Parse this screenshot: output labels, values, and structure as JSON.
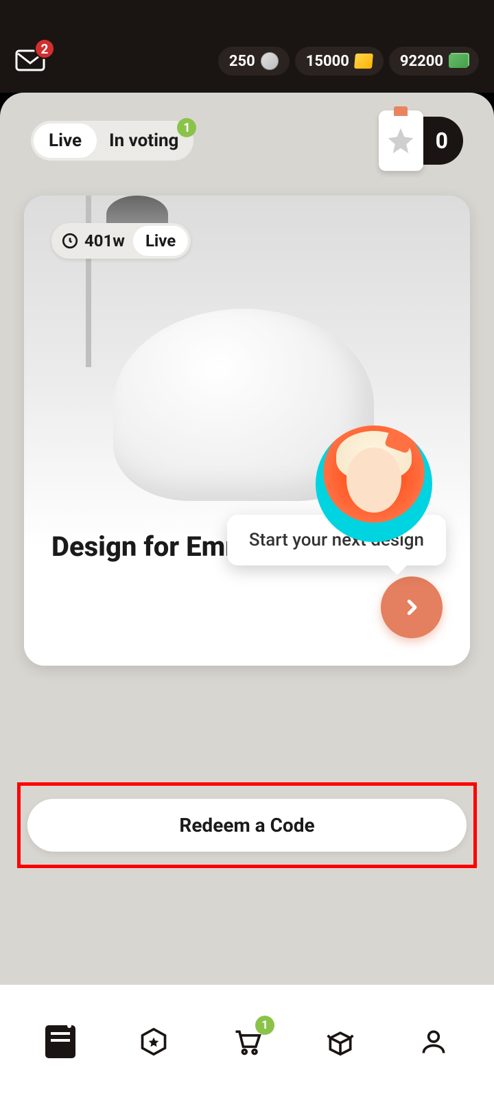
{
  "header": {
    "mail_badge": "2",
    "currency": {
      "coins": "250",
      "gold": "15000",
      "cash": "92200"
    }
  },
  "tabs": {
    "live": "Live",
    "in_voting": "In voting",
    "voting_badge": "1"
  },
  "star_pill": {
    "count": "0"
  },
  "card": {
    "time": "401w",
    "status": "Live",
    "title": "Design for Emma",
    "tooltip": "Start your next design"
  },
  "redeem": {
    "label": "Redeem a Code"
  },
  "bottom_nav": {
    "cart_badge": "1"
  }
}
